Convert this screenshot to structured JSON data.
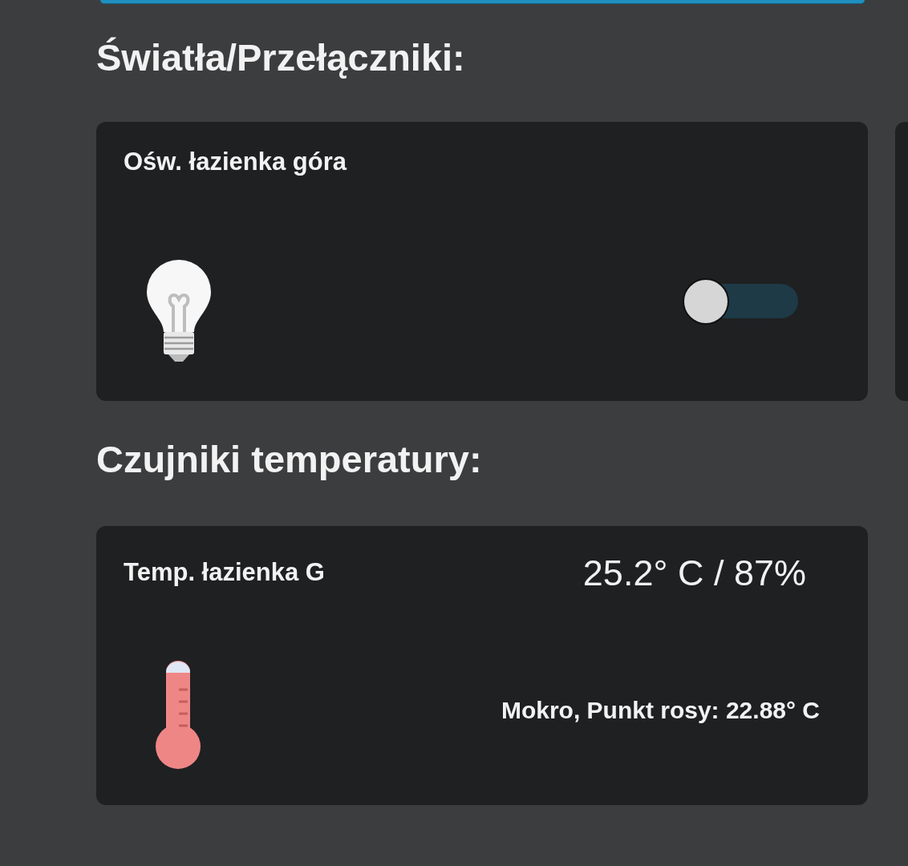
{
  "sections": [
    {
      "kind": "switches",
      "heading": "Światła/Przełączniki:",
      "cards": [
        {
          "title": "Ośw. łazienka góra",
          "on": false
        }
      ]
    },
    {
      "kind": "sensors",
      "heading": "Czujniki temperatury:",
      "cards": [
        {
          "title": "Temp. łazienka G",
          "reading": "25.2° C / 87%",
          "status": "Mokro, Punkt rosy: 22.88° C"
        }
      ]
    }
  ]
}
